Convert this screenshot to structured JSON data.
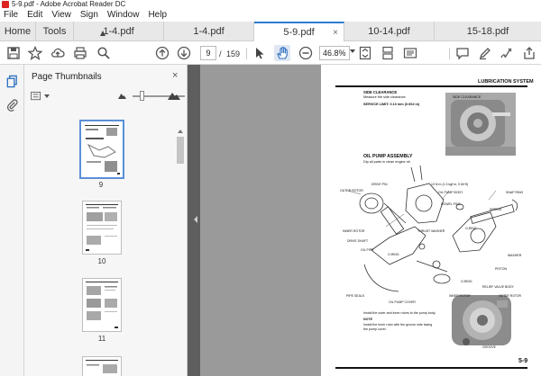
{
  "window": {
    "title": "5-9.pdf - Adobe Acrobat Reader DC"
  },
  "menu": [
    "File",
    "Edit",
    "View",
    "Sign",
    "Window",
    "Help"
  ],
  "tabs": {
    "home": "Home",
    "tools": "Tools",
    "docs": [
      "1-4.pdf",
      "1-4.pdf",
      "5-9.pdf",
      "10-14.pdf",
      "15-18.pdf"
    ],
    "active_index": 2,
    "close_glyph": "×"
  },
  "toolbar": {
    "page_current": "9",
    "page_sep": "/",
    "page_total": "159",
    "zoom": "46.8%"
  },
  "thumbnails": {
    "title": "Page Thumbnails",
    "close": "×",
    "labels": [
      "9",
      "10",
      "11"
    ],
    "selected": "9"
  },
  "page": {
    "header": "LUBRICATION SYSTEM",
    "side_clearance_title": "SIDE CLEARANCE",
    "side_clearance_text": "Measure the side clearance.",
    "service_limit": "SERVICE LIMIT:  0.10 mm (0.004 in)",
    "side_clearance_photo_label": "SIDE CLEARANCE",
    "assembly_title": "OIL PUMP ASSEMBLY",
    "assembly_sub": "Dip all parts in clean engine oil.",
    "labels": {
      "outer_rotor": "OUTER ROTOR",
      "drive_pin": "DRIVE PIN",
      "torque": "13 N·m (1.3 kgf·m, 9 lbf·ft)",
      "pump_body": "OIL PUMP BODY",
      "dowel_pins": "DOWEL PINS",
      "snap_ring": "SNAP RING",
      "spring": "SPRING",
      "inner_rotor": "INNER ROTOR",
      "thrust_washer": "THRUST WASHER",
      "o_ring_1": "O-RING",
      "drive_shaft": "DRIVE SHAFT",
      "oil_pipe": "OIL PIPE",
      "o_ring_2": "O-RING",
      "washer": "WASHER",
      "piston": "PISTON",
      "o_ring_3": "O-RING",
      "relief_valve_body": "RELIEF VALVE BODY",
      "pipe_seals": "PIPE SEALS",
      "oil_pump_cover": "OIL PUMP COVER",
      "oil_strainer": "OIL STRAINER"
    },
    "install_text": "Install the outer and inner rotors to the pump body.",
    "note": "NOTE",
    "note_text_1": "Install the inner rotor with the groove side facing",
    "note_text_2": "the pump cover.",
    "photo2_inner": "INNER ROTOR",
    "photo2_outer": "OUTER ROTOR",
    "photo2_groove": "GROOVE",
    "page_number": "5-9"
  }
}
